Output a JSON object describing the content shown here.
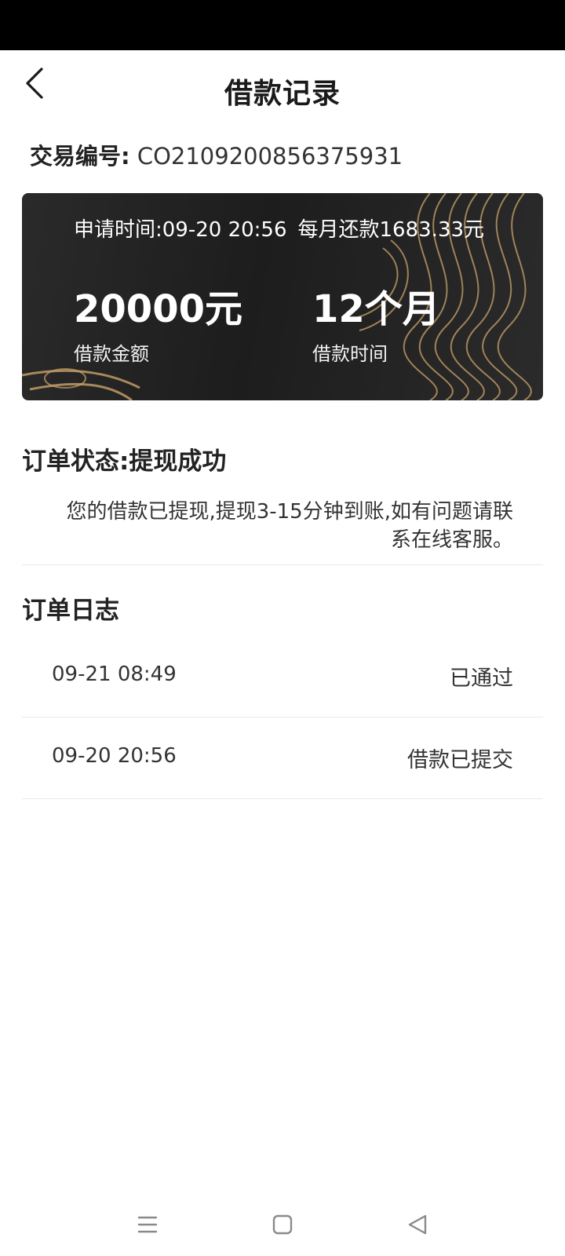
{
  "header": {
    "title": "借款记录"
  },
  "transaction": {
    "label": "交易编号:",
    "number": "CO2109200856375931"
  },
  "card": {
    "apply_time_label": "申请时间:",
    "apply_time": "09-20 20:56",
    "monthly_repayment": "每月还款1683.33元",
    "amount_value": "20000元",
    "amount_label": "借款金额",
    "term_value": "12个月",
    "term_label": "借款时间"
  },
  "order_status": {
    "title": "订单状态:提现成功",
    "description": "您的借款已提现,提现3-15分钟到账,如有问题请联系在线客服。"
  },
  "order_log": {
    "title": "订单日志",
    "entries": [
      {
        "time": "09-21 08:49",
        "status": "已通过"
      },
      {
        "time": "09-20 20:56",
        "status": "借款已提交"
      }
    ]
  },
  "nav": {
    "icons": [
      "menu-icon",
      "home-square-icon",
      "back-triangle-icon"
    ]
  },
  "colors": {
    "card_bg": "#222222",
    "card_gold": "#c9a26a",
    "text_primary": "#222222"
  }
}
